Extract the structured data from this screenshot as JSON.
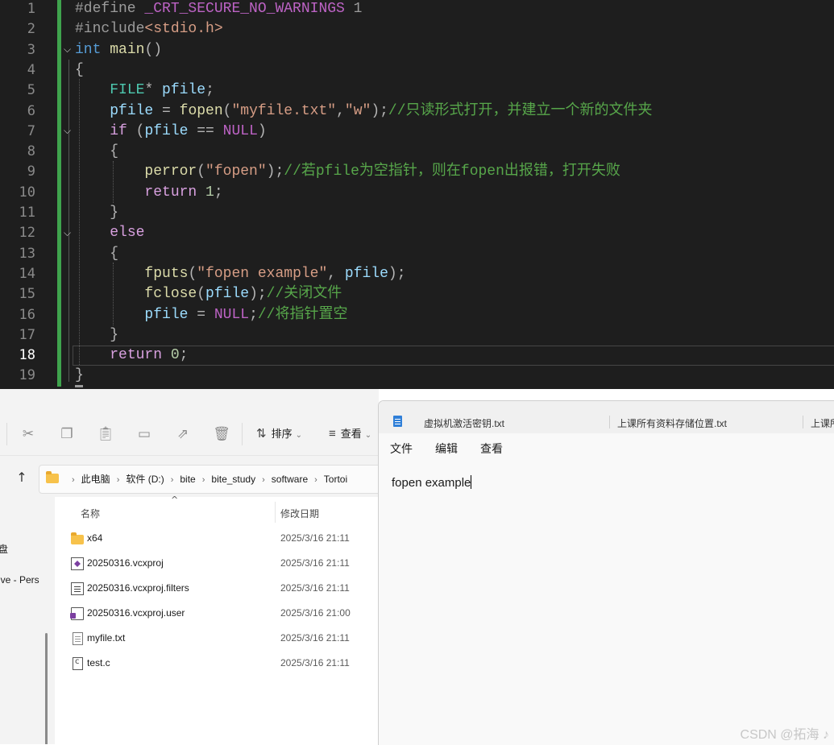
{
  "editor": {
    "line_numbers": [
      "1",
      "2",
      "3",
      "4",
      "5",
      "6",
      "7",
      "8",
      "9",
      "10",
      "11",
      "12",
      "13",
      "14",
      "15",
      "16",
      "17",
      "18",
      "19"
    ],
    "current_line": "18",
    "lines": [
      {
        "n": 1,
        "tokens": [
          {
            "t": "#define ",
            "c": "pp"
          },
          {
            "t": "_CRT_SECURE_NO_WARNINGS",
            "c": "mac"
          },
          {
            "t": " 1",
            "c": "pp"
          }
        ]
      },
      {
        "n": 2,
        "tokens": [
          {
            "t": "#include",
            "c": "pp"
          },
          {
            "t": "<stdio.h>",
            "c": "str"
          }
        ]
      },
      {
        "n": 3,
        "tokens": [
          {
            "t": "int",
            "c": "kw"
          },
          {
            "t": " ",
            "c": ""
          },
          {
            "t": "main",
            "c": "fn"
          },
          {
            "t": "()",
            "c": "op"
          }
        ]
      },
      {
        "n": 4,
        "tokens": [
          {
            "t": "{",
            "c": "op"
          }
        ]
      },
      {
        "n": 5,
        "tokens": [
          {
            "t": "    ",
            "c": ""
          },
          {
            "t": "FILE",
            "c": "ty"
          },
          {
            "t": "* ",
            "c": "op"
          },
          {
            "t": "pfile",
            "c": "var"
          },
          {
            "t": ";",
            "c": "op"
          }
        ]
      },
      {
        "n": 6,
        "tokens": [
          {
            "t": "    ",
            "c": ""
          },
          {
            "t": "pfile",
            "c": "var"
          },
          {
            "t": " = ",
            "c": "op"
          },
          {
            "t": "fopen",
            "c": "fn"
          },
          {
            "t": "(",
            "c": "op"
          },
          {
            "t": "\"myfile.txt\"",
            "c": "str"
          },
          {
            "t": ",",
            "c": "op"
          },
          {
            "t": "\"w\"",
            "c": "str"
          },
          {
            "t": ");",
            "c": "op"
          },
          {
            "t": "//只读形式打开，并建立一个新的文件夹",
            "c": "com"
          }
        ]
      },
      {
        "n": 7,
        "tokens": [
          {
            "t": "    ",
            "c": ""
          },
          {
            "t": "if",
            "c": "kw2"
          },
          {
            "t": " (",
            "c": "op"
          },
          {
            "t": "pfile",
            "c": "var"
          },
          {
            "t": " == ",
            "c": "op"
          },
          {
            "t": "NULL",
            "c": "mac"
          },
          {
            "t": ")",
            "c": "op"
          }
        ]
      },
      {
        "n": 8,
        "tokens": [
          {
            "t": "    ",
            "c": ""
          },
          {
            "t": "{",
            "c": "op"
          }
        ]
      },
      {
        "n": 9,
        "tokens": [
          {
            "t": "        ",
            "c": ""
          },
          {
            "t": "perror",
            "c": "fn"
          },
          {
            "t": "(",
            "c": "op"
          },
          {
            "t": "\"fopen\"",
            "c": "str"
          },
          {
            "t": ");",
            "c": "op"
          },
          {
            "t": "//若pfile为空指针，则在fopen出报错，打开失败",
            "c": "com"
          }
        ]
      },
      {
        "n": 10,
        "tokens": [
          {
            "t": "        ",
            "c": ""
          },
          {
            "t": "return",
            "c": "kw2"
          },
          {
            "t": " ",
            "c": ""
          },
          {
            "t": "1",
            "c": "num"
          },
          {
            "t": ";",
            "c": "op"
          }
        ]
      },
      {
        "n": 11,
        "tokens": [
          {
            "t": "    ",
            "c": ""
          },
          {
            "t": "}",
            "c": "op"
          }
        ]
      },
      {
        "n": 12,
        "tokens": [
          {
            "t": "    ",
            "c": ""
          },
          {
            "t": "else",
            "c": "kw2"
          }
        ]
      },
      {
        "n": 13,
        "tokens": [
          {
            "t": "    ",
            "c": ""
          },
          {
            "t": "{",
            "c": "op"
          }
        ]
      },
      {
        "n": 14,
        "tokens": [
          {
            "t": "        ",
            "c": ""
          },
          {
            "t": "fputs",
            "c": "fn"
          },
          {
            "t": "(",
            "c": "op"
          },
          {
            "t": "\"fopen example\"",
            "c": "str"
          },
          {
            "t": ", ",
            "c": "op"
          },
          {
            "t": "pfile",
            "c": "var"
          },
          {
            "t": ");",
            "c": "op"
          }
        ]
      },
      {
        "n": 15,
        "tokens": [
          {
            "t": "        ",
            "c": ""
          },
          {
            "t": "fclose",
            "c": "fn"
          },
          {
            "t": "(",
            "c": "op"
          },
          {
            "t": "pfile",
            "c": "var"
          },
          {
            "t": ");",
            "c": "op"
          },
          {
            "t": "//关闭文件",
            "c": "com"
          }
        ]
      },
      {
        "n": 16,
        "tokens": [
          {
            "t": "        ",
            "c": ""
          },
          {
            "t": "pfile",
            "c": "var"
          },
          {
            "t": " = ",
            "c": "op"
          },
          {
            "t": "NULL",
            "c": "mac"
          },
          {
            "t": ";",
            "c": "op"
          },
          {
            "t": "//将指针置空",
            "c": "com"
          }
        ]
      },
      {
        "n": 17,
        "tokens": [
          {
            "t": "    ",
            "c": ""
          },
          {
            "t": "}",
            "c": "op"
          }
        ]
      },
      {
        "n": 18,
        "tokens": [
          {
            "t": "    ",
            "c": ""
          },
          {
            "t": "return",
            "c": "kw2"
          },
          {
            "t": " ",
            "c": ""
          },
          {
            "t": "0",
            "c": "num"
          },
          {
            "t": ";",
            "c": "op"
          }
        ]
      },
      {
        "n": 19,
        "tokens": [
          {
            "t": "}",
            "c": "op"
          }
        ]
      }
    ]
  },
  "explorer": {
    "toolbar": {
      "sort_label": "排序",
      "view_label": "查看"
    },
    "breadcrumb": [
      "此电脑",
      "软件 (D:)",
      "bite",
      "bite_study",
      "software",
      "Tortoi"
    ],
    "nav_items": [
      "盘",
      "ive - Pers"
    ],
    "columns": {
      "name": "名称",
      "modified": "修改日期"
    },
    "files": [
      {
        "name": "x64",
        "date": "2025/3/16 21:11",
        "icon": "folder-icon"
      },
      {
        "name": "20250316.vcxproj",
        "date": "2025/3/16 21:11",
        "icon": "vcxproj-icon"
      },
      {
        "name": "20250316.vcxproj.filters",
        "date": "2025/3/16 21:11",
        "icon": "filters-icon"
      },
      {
        "name": "20250316.vcxproj.user",
        "date": "2025/3/16 21:00",
        "icon": "user-file-icon"
      },
      {
        "name": "myfile.txt",
        "date": "2025/3/16 21:11",
        "icon": "text-file-icon"
      },
      {
        "name": "test.c",
        "date": "2025/3/16 21:11",
        "icon": "c-file-icon"
      }
    ]
  },
  "notepad": {
    "tabs": [
      "虚拟机激活密钥.txt",
      "上课所有资料存储位置.txt",
      "上课所"
    ],
    "menu": [
      "文件",
      "编辑",
      "查看"
    ],
    "content": "fopen example"
  },
  "watermark": "CSDN @拓海 ♪"
}
